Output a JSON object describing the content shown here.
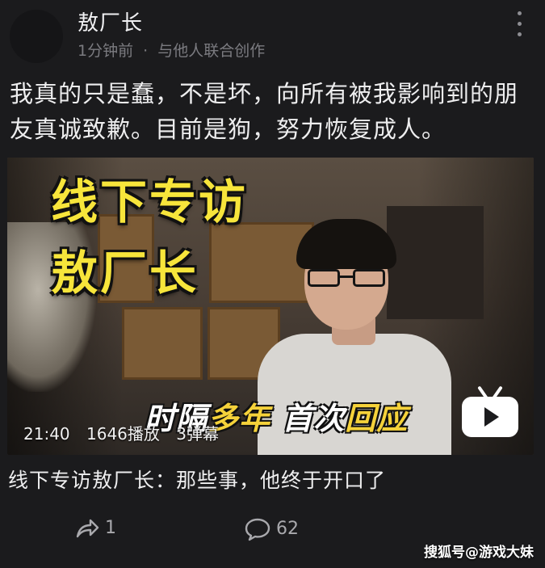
{
  "post": {
    "author": "敖厂长",
    "time": "1分钟前",
    "meta_separator": "·",
    "meta_extra": "与他人联合创作",
    "text": "我真的只是蠢，不是坏，向所有被我影响到的朋友真诚致歉。目前是狗，努力恢复成人。"
  },
  "video": {
    "title_line1": "线下专访",
    "title_line2": "敖厂长",
    "subtitle_part1": "时隔",
    "subtitle_highlight": "多年",
    "subtitle_part2": " 首次",
    "subtitle_highlight2": "回应",
    "duration": "21:40",
    "plays": "1646播放",
    "danmaku": "3弹幕",
    "caption": "线下专访敖厂长：那些事，他终于开口了"
  },
  "actions": {
    "share_count": "1",
    "comment_count": "62"
  },
  "watermark": "搜狐号@游戏大妹",
  "icons": {
    "more": "more-vertical-icon",
    "share": "share-icon",
    "comment": "comment-icon",
    "bilibili": "bilibili-tv-icon"
  }
}
